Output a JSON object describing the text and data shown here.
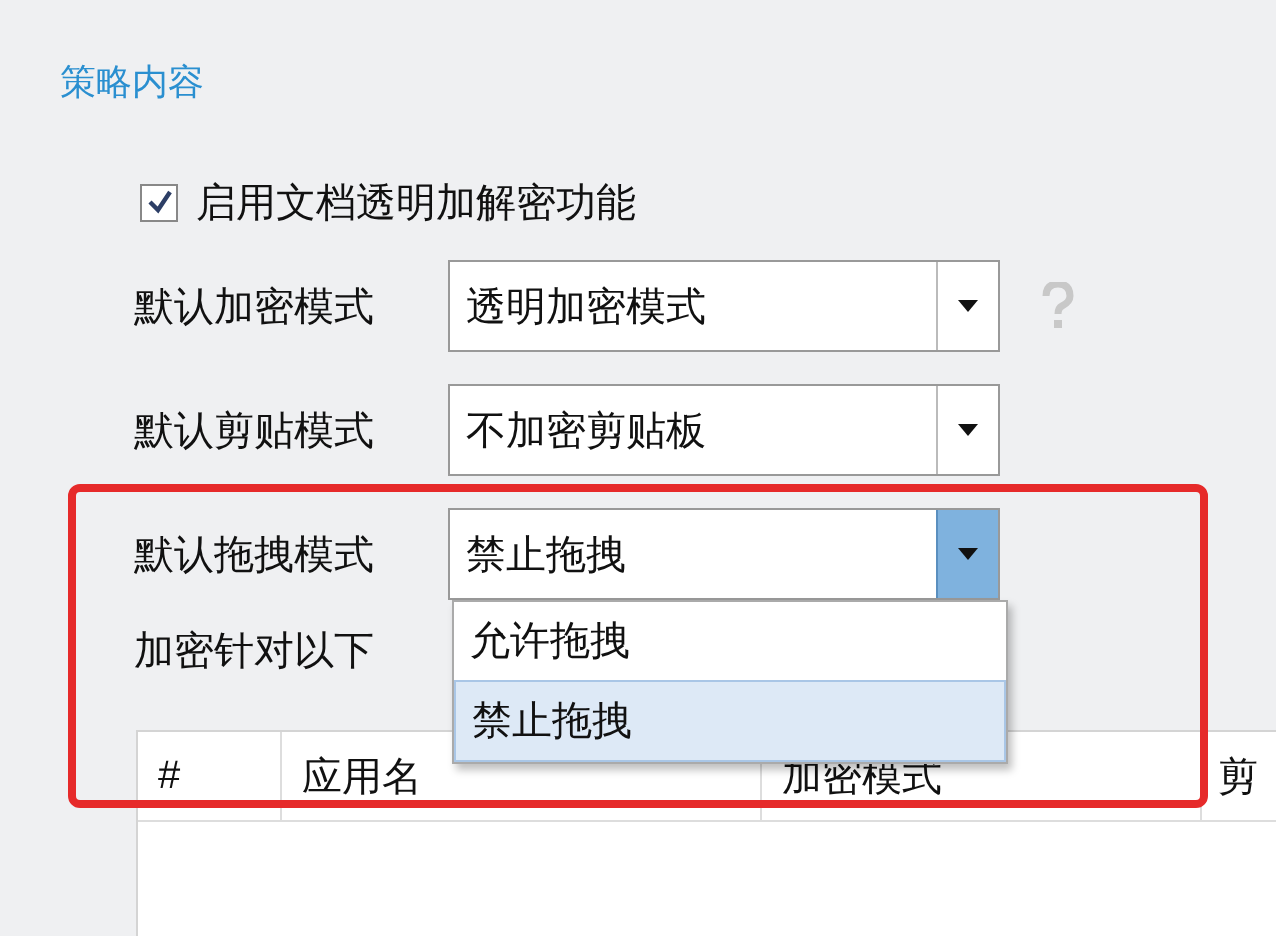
{
  "section_title": "策略内容",
  "enable_option": {
    "label": "启用文档透明加解密功能",
    "checked": true
  },
  "settings": [
    {
      "label": "默认加密模式",
      "value": "透明加密模式",
      "expanded": false,
      "help": true
    },
    {
      "label": "默认剪贴模式",
      "value": "不加密剪贴板",
      "expanded": false,
      "help": false
    },
    {
      "label": "默认拖拽模式",
      "value": "禁止拖拽",
      "expanded": true,
      "help": false,
      "options": [
        {
          "label": "允许拖拽",
          "selected": false
        },
        {
          "label": "禁止拖拽",
          "selected": true
        }
      ]
    }
  ],
  "note": "加密针对以下",
  "table": {
    "columns": [
      "#",
      "应用名",
      "加密模式",
      "剪"
    ]
  }
}
